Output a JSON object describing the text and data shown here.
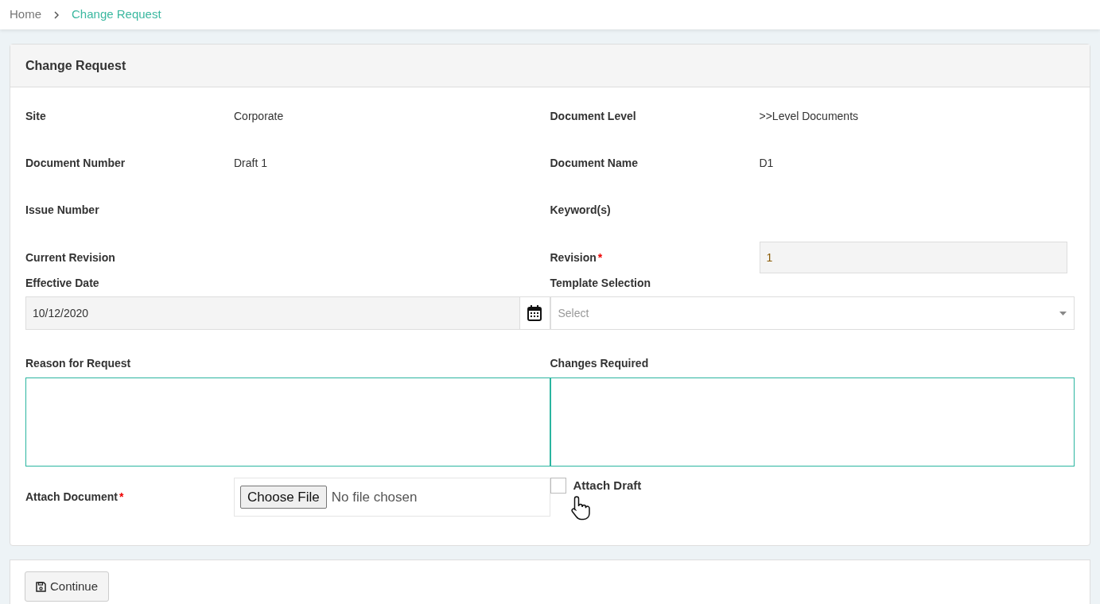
{
  "breadcrumb": [
    {
      "label": "Home",
      "selected": false
    },
    {
      "label": "Change Request",
      "selected": true
    }
  ],
  "card": {
    "title": "Change Request"
  },
  "info_rows": [
    {
      "left": {
        "label": "Site",
        "value": "Corporate"
      },
      "right": {
        "label": "Document Level",
        "value": ">>Level Documents"
      }
    },
    {
      "left": {
        "label": "Document Number",
        "value": "Draft 1"
      },
      "right": {
        "label": "Document Name",
        "value": "D1"
      }
    },
    {
      "left": {
        "label": "Issue Number"
      },
      "right": {
        "label": "Keyword(s)"
      }
    }
  ],
  "current_revision": {
    "label": "Current Revision"
  },
  "revision": {
    "label": "Revision",
    "required_mark": "*",
    "value": "1"
  },
  "effective_date": {
    "label": "Effective Date",
    "value": "10/12/2020"
  },
  "template_selection": {
    "label": "Template Selection",
    "placeholder": "Select"
  },
  "reason_for_request": {
    "label": "Reason for Request"
  },
  "changes_required": {
    "label": "Changes Required"
  },
  "attach_document": {
    "label": "Attach Document",
    "required_mark": "*",
    "button": "Choose File",
    "status": "No file chosen"
  },
  "attach_draft": {
    "label": "Attach Draft",
    "checked": false
  },
  "continue_button": {
    "label": "Continue"
  }
}
